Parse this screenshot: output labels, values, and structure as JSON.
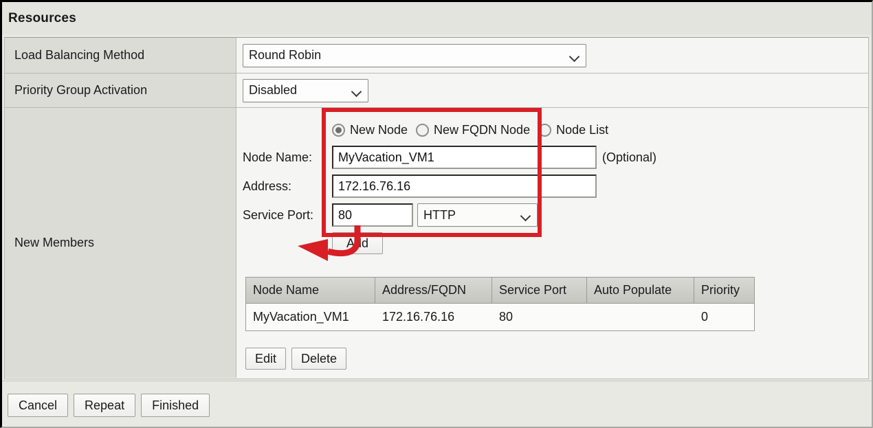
{
  "section": {
    "title": "Resources"
  },
  "rows": {
    "load_balancing": {
      "label": "Load Balancing Method",
      "value": "Round Robin"
    },
    "priority_group": {
      "label": "Priority Group Activation",
      "value": "Disabled"
    },
    "new_members": {
      "label": "New Members"
    }
  },
  "node_source": {
    "options": [
      {
        "label": "New Node",
        "selected": true
      },
      {
        "label": "New FQDN Node",
        "selected": false
      },
      {
        "label": "Node List",
        "selected": false
      }
    ]
  },
  "fields": {
    "node_name": {
      "label": "Node Name:",
      "value": "MyVacation_VM1",
      "hint": "(Optional)"
    },
    "address": {
      "label": "Address:",
      "value": "172.16.76.16"
    },
    "service_port": {
      "label": "Service Port:",
      "value": "80",
      "protocol": "HTTP"
    }
  },
  "buttons": {
    "add": "Add",
    "edit": "Edit",
    "delete": "Delete",
    "cancel": "Cancel",
    "repeat": "Repeat",
    "finished": "Finished"
  },
  "members_table": {
    "columns": [
      "Node Name",
      "Address/FQDN",
      "Service Port",
      "Auto Populate",
      "Priority"
    ],
    "rows": [
      {
        "node_name": "MyVacation_VM1",
        "address": "172.16.76.16",
        "service_port": "80",
        "auto_populate": "",
        "priority": "0"
      }
    ]
  },
  "annotation": {
    "highlight_color": "#d81f26",
    "arrow_color": "#d81f26",
    "target": "Add"
  },
  "icons": {
    "chevron_down": "chevron-down-icon",
    "radio_selected": "radio-selected-icon",
    "radio_unselected": "radio-unselected-icon"
  }
}
